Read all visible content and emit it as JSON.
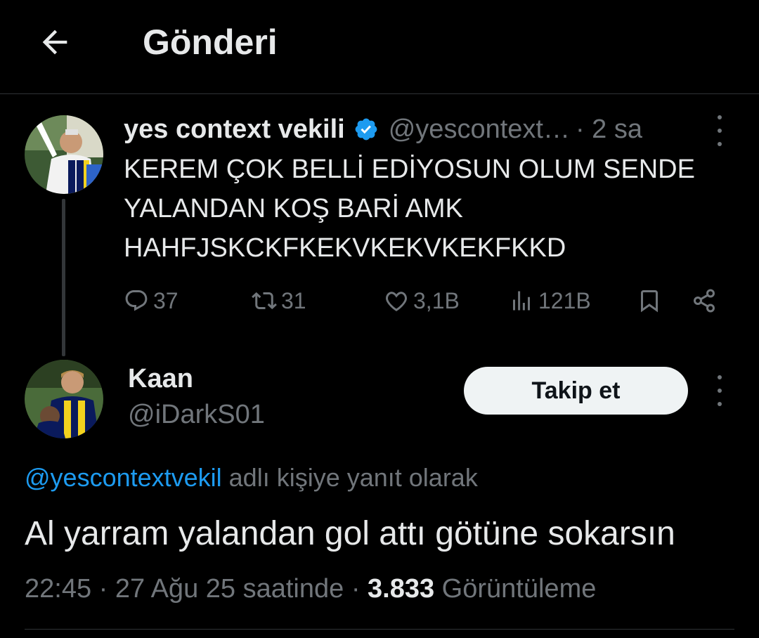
{
  "header": {
    "title": "Gönderi",
    "back_icon": "arrow-left-icon"
  },
  "parent_tweet": {
    "author_name": "yes context vekili",
    "verified_color": "#1d9bf0",
    "handle": "@yescontext…",
    "time": "· 2 sa",
    "text": "KEREM ÇOK BELLİ EDİYOSUN OLUM SENDE\nYALANDAN KOŞ BARİ AMK\nHAHFJSKCKFKEKVKEKVKEKFKKD",
    "replies": "37",
    "reposts": "31",
    "likes": "3,1B",
    "views": "121B"
  },
  "reply_tweet": {
    "author_name": "Kaan",
    "handle": "@iDarkS01",
    "follow_label": "Takip et",
    "reply_to_mention": "@yescontextvekil",
    "reply_to_suffix": " adlı kişiye yanıt olarak",
    "text": "Al yarram yalandan gol attı götüne sokarsın",
    "time": "22:45 · 27 Ağu 25 saatinde · ",
    "view_count": "3.833",
    "view_label": " Görüntüleme"
  },
  "colors": {
    "background": "#000000",
    "accent": "#1d9bf0",
    "muted": "#71767b",
    "text": "#e7e9ea"
  }
}
